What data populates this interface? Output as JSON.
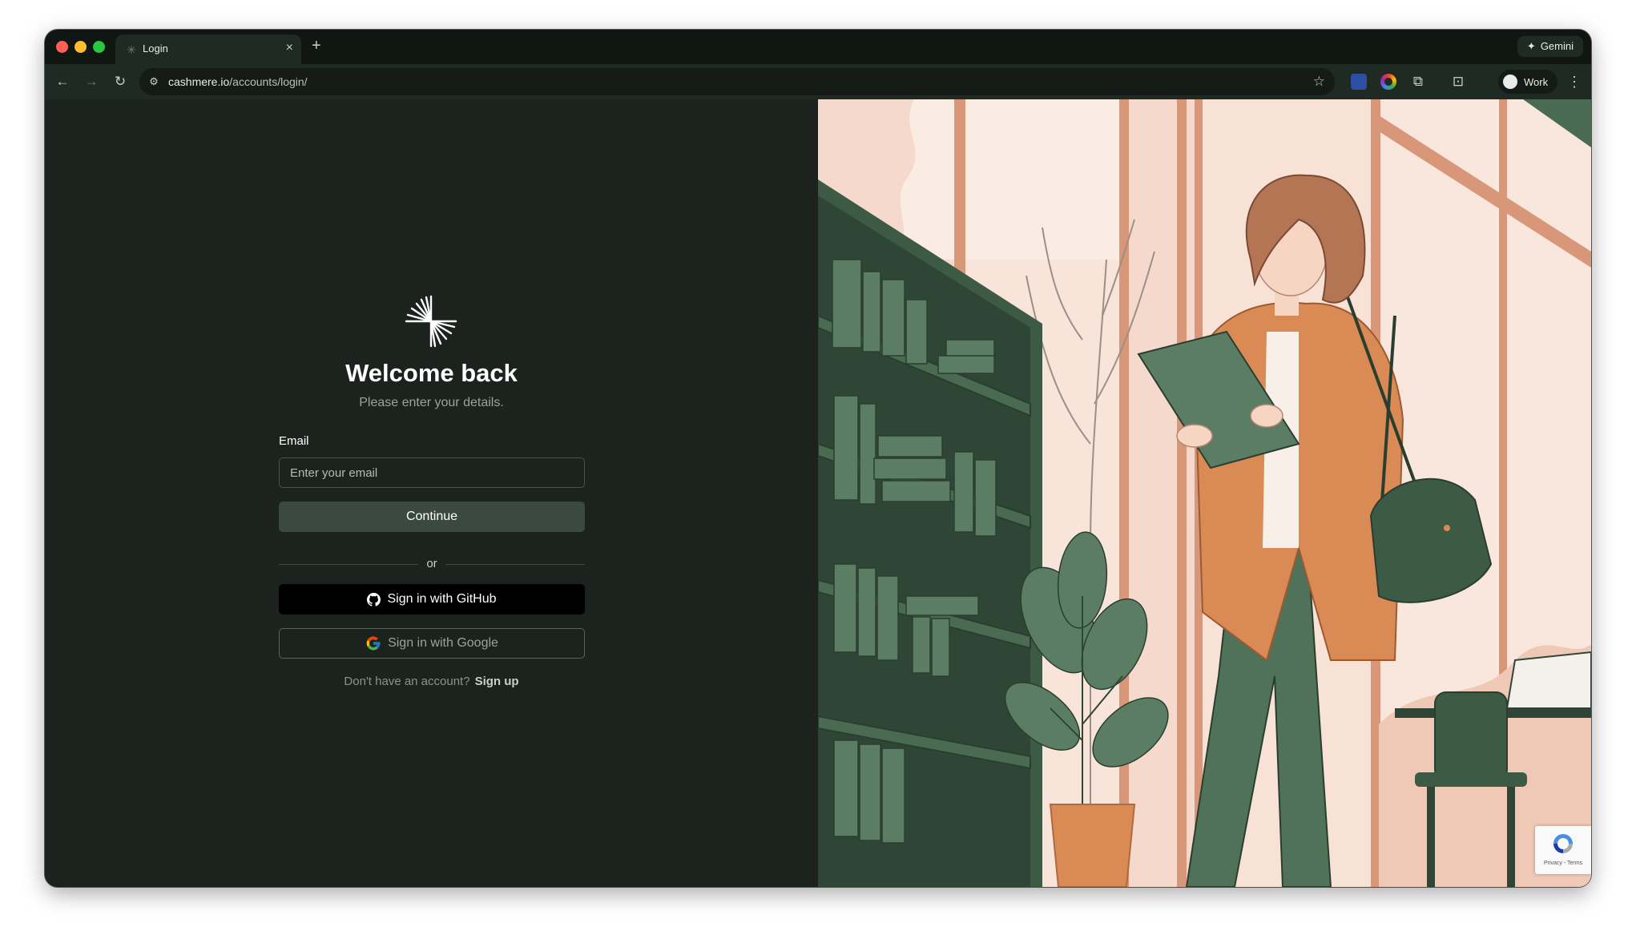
{
  "browser": {
    "tab_title": "Login",
    "tab_close": "×",
    "new_tab": "+",
    "gemini_label": "Gemini",
    "url_domain": "cashmere.io",
    "url_path": "/accounts/login/",
    "profile_label": "Work"
  },
  "login": {
    "title": "Welcome back",
    "subtitle": "Please enter your details.",
    "email_label": "Email",
    "email_placeholder": "Enter your email",
    "email_value": "",
    "continue_label": "Continue",
    "divider_text": "or",
    "github_label": "Sign in with GitHub",
    "google_label": "Sign in with Google",
    "signup_prompt": "Don't have an account?",
    "signup_link": "Sign up"
  },
  "recaptcha": {
    "text": "Privacy - Terms"
  },
  "colors": {
    "page_bg": "#1c231e",
    "continue_bg": "#3a4a40",
    "illustration_bg": "#f4d9cc",
    "illustration_green": "#4a6b52",
    "illustration_orange": "#d98a55"
  },
  "icons": [
    "tab-favicon-icon",
    "close-icon",
    "plus-icon",
    "sparkle-icon",
    "back-icon",
    "forward-icon",
    "reload-icon",
    "site-settings-icon",
    "star-icon",
    "extension-icon",
    "puzzle-icon",
    "tab-search-icon",
    "avatar-icon",
    "kebab-menu-icon",
    "logo-burst-icon",
    "github-icon",
    "google-icon",
    "recaptcha-icon"
  ]
}
